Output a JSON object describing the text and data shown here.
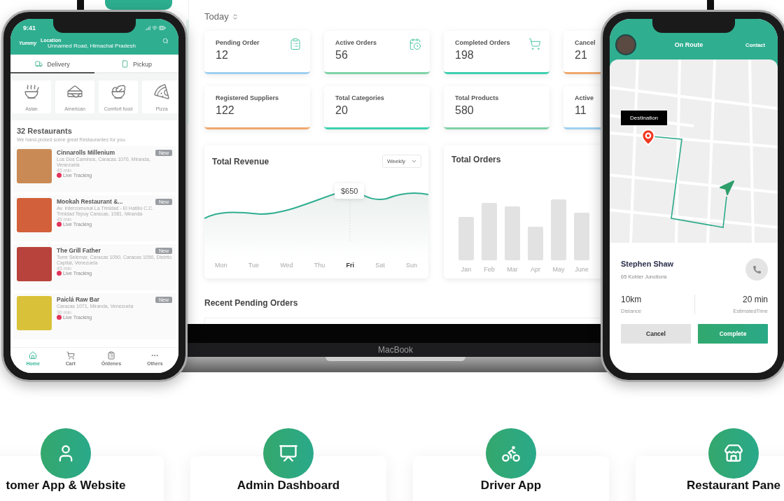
{
  "customer_phone": {
    "time": "9:41",
    "brand": "Yummy",
    "location_label": "Location",
    "location": "Unnamed Road, Himachal Pradesh",
    "tabs": [
      {
        "label": "Delivery",
        "selected": true
      },
      {
        "label": "Pickup",
        "selected": false
      }
    ],
    "categories": [
      "Asian",
      "American",
      "Comfort food",
      "Pizza"
    ],
    "heading": "32 Restaurants",
    "subheading": "We hand-picked some great Restaurantes for you.",
    "restaurants": [
      {
        "name": "Cinnarolls Millenium",
        "badge": "New",
        "address": "Los Dos Caminos, Caracas 1070, Miranda, Venezuela",
        "time": "45 min",
        "tracking": "Live Tracking"
      },
      {
        "name": "Mookah Restaurant &...",
        "badge": "New",
        "address": "Av. Intercomunal La Trinidad - El Hatillo C.C. Trinidad Tepuy Caracas, 1081, Miranda",
        "time": "45 min",
        "tracking": "Live Tracking"
      },
      {
        "name": "The Grill Father",
        "badge": "New",
        "address": "Torre Selemar, Caracas 1050, Caracas 1050, Distrito Capital, Venezuela",
        "time": "45 min",
        "tracking": "Live Tracking"
      },
      {
        "name": "Paiclá Raw Bar",
        "badge": "New",
        "address": "Caracas 1071, Miranda, Venezuela",
        "time": "30 min",
        "tracking": "Live Tracking"
      }
    ],
    "nav": [
      {
        "label": "Home",
        "selected": true
      },
      {
        "label": "Cart",
        "selected": false
      },
      {
        "label": "Órdenes",
        "selected": false
      },
      {
        "label": "Others",
        "selected": false
      }
    ]
  },
  "dashboard": {
    "period": "Today",
    "stats": [
      {
        "label": "Pending Order",
        "value": "12",
        "color": "#9fd0f0"
      },
      {
        "label": "Active Orders",
        "value": "56",
        "color": "#7fd3a8"
      },
      {
        "label": "Completed Orders",
        "value": "198",
        "color": "#3fd0b0"
      },
      {
        "label": "Cancel",
        "value": "21",
        "color": "#f0a86c"
      },
      {
        "label": "Registered Suppliers",
        "value": "122",
        "color": "#f0a86c"
      },
      {
        "label": "Total Categories",
        "value": "20",
        "color": "#3fd0b0"
      },
      {
        "label": "Total Products",
        "value": "580",
        "color": "#7fd3a8"
      },
      {
        "label": "Active",
        "value": "11",
        "color": "#9fd0f0"
      }
    ],
    "revenue": {
      "title": "Total Revenue",
      "filter": "Weekly",
      "tooltip": "$650",
      "days": [
        {
          "label": "Mon",
          "selected": false
        },
        {
          "label": "Tue",
          "selected": false
        },
        {
          "label": "Wed",
          "selected": false
        },
        {
          "label": "Thu",
          "selected": false
        },
        {
          "label": "Fri",
          "selected": true
        },
        {
          "label": "Sat",
          "selected": false
        },
        {
          "label": "Sun",
          "selected": false
        }
      ]
    },
    "orders": {
      "title": "Total Orders",
      "months": [
        "Jan",
        "Feb",
        "Mar",
        "Apr",
        "May",
        "June"
      ]
    },
    "recent_title": "Recent Pending Orders"
  },
  "laptop_brand": "MacBook",
  "driver_phone": {
    "title": "On Route",
    "action": "Contact",
    "marker_label": "Destination",
    "customer": "Stephen Shaw",
    "address": "65 Kohler Junctions",
    "distance": "10km",
    "distance_label": "Distance",
    "time": "20 min",
    "time_label": "EstimatedTime",
    "buttons": [
      {
        "label": "Cancel",
        "kind": "secondary"
      },
      {
        "label": "Complete",
        "kind": "primary"
      }
    ]
  },
  "features": [
    {
      "title": "tomer App & Website"
    },
    {
      "title": "Admin Dashboard"
    },
    {
      "title": "Driver App"
    },
    {
      "title": "Restaurant Pane"
    }
  ]
}
